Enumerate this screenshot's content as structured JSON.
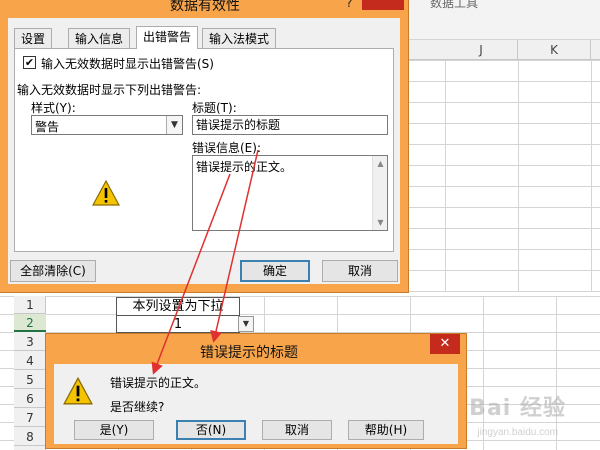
{
  "background": {
    "ribbon_tab": "数据工具",
    "columns": [
      "J",
      "K"
    ],
    "row_numbers": [
      "1",
      "2",
      "3",
      "4",
      "5",
      "6",
      "7",
      "8"
    ],
    "cell_a1": "本列设置为下拉",
    "cell_a2": "1"
  },
  "validation_dialog": {
    "title": "数据有效性",
    "help": "?",
    "tabs": [
      "设置",
      "输入信息",
      "出错警告",
      "输入法模式"
    ],
    "checkbox_label": "输入无效数据时显示出错警告(S)",
    "section_label": "输入无效数据时显示下列出错警告:",
    "style_label": "样式(Y):",
    "style_value": "警告",
    "title_label": "标题(T):",
    "title_value": "错误提示的标题",
    "message_label": "错误信息(E):",
    "message_value": "错误提示的正文。",
    "clear_all": "全部清除(C)",
    "ok": "确定",
    "cancel": "取消"
  },
  "error_dialog": {
    "title": "错误提示的标题",
    "close": "✕",
    "message": "错误提示的正文。",
    "question": "是否继续?",
    "yes": "是(Y)",
    "no": "否(N)",
    "cancel": "取消",
    "help": "帮助(H)"
  },
  "colors": {
    "frame": "#f7a44a",
    "arrow": "#e03030",
    "close": "#c42b1c"
  },
  "watermark": {
    "text": "Bai 经验",
    "sub": "jingyan.baidu.com"
  }
}
